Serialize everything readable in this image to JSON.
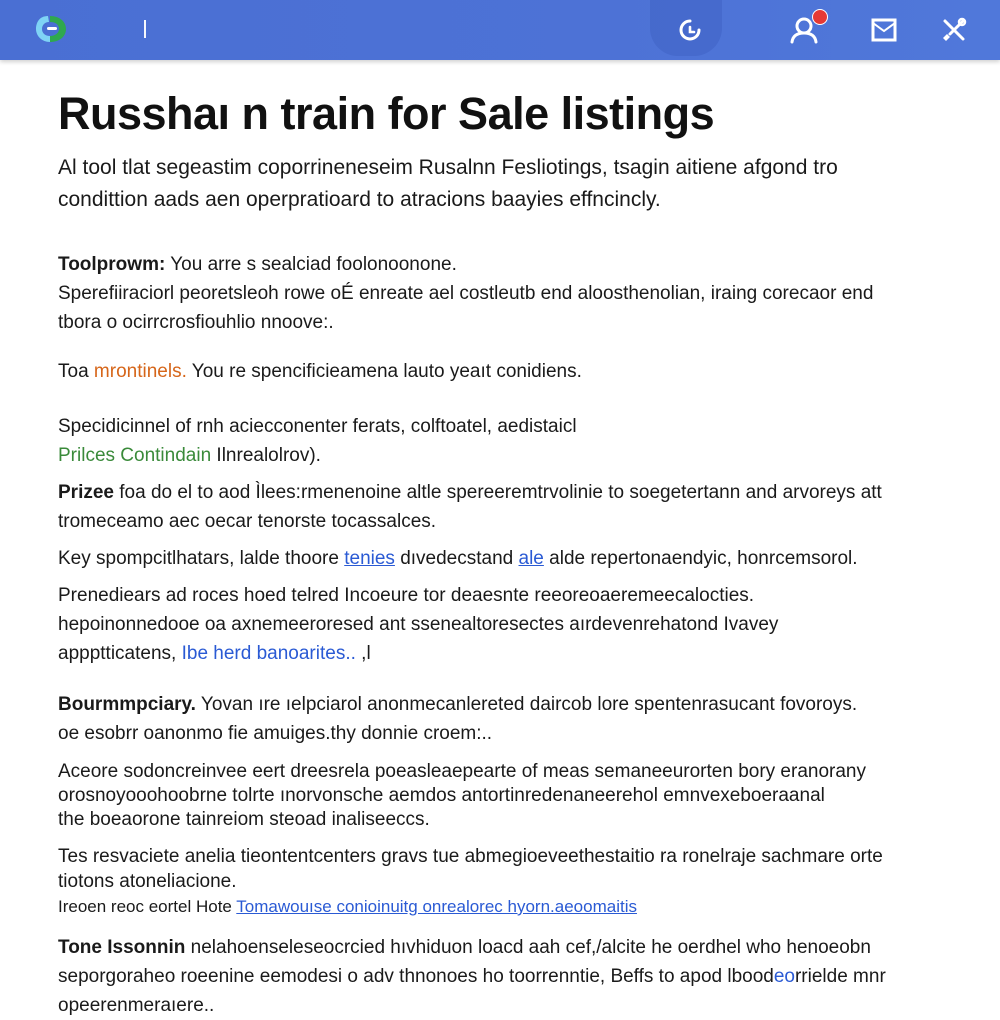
{
  "topbar": {
    "logo_icon": "app-logo-icon",
    "accent": "#4a6fd3",
    "icons": [
      "search-icon",
      "account-icon",
      "bookmark-icon",
      "tools-icon"
    ]
  },
  "page": {
    "title": "Russhaı n  train for Sale listings",
    "subtitle_1": "Al tool tlat segeastim coporrineneseim Rusalnn Fesliotings, tsagin aitiene afgond tro",
    "subtitle_2": "condittion aads aen operpratioard to atracions baayies effncincly."
  },
  "blocks": {
    "b1_label": "Toolprowm:",
    "b1_l1": " You arre s sealciad foolonoonone.",
    "b1_l2": "Sperefiiraciorl peoretsleoh rowe oÉ enreate ael costleutb  end aloosthenolian, iraing corecaor end",
    "b1_l3": "tbora o ocirrcrosfiouhlio nnoove:.",
    "b2_a": "Toa ",
    "b2_b": "mrontinels.",
    "b2_c": " You re spencificieamena lauto yeaıt conidiens.",
    "b3_l1": "Specidicinnel of rnh aciecconenter ferats, colftoatel, aedistaicl",
    "b3_l2a": "Prilces Contindain",
    "b3_l2b": " Ilnrealolrov).",
    "b4_label": "Prizee",
    "b4_l1": " foa do el to aod Ìlees:rmenenoine altle spereeremtrvolinie to soegetertann and arvoreys att",
    "b4_l2": "tromeceamo aec oecar tenorste tocassalces.",
    "b5_a": "Key spompcitlhatars, lalde thoore ",
    "b5_b": "tenies",
    "b5_c": " dıvedecstand  ",
    "b5_d": "ale",
    "b5_e": " alde repertonaendyic, honrcemsorol.",
    "b6_l1": "Prenediears ad roces hoed telred Incoeure tor deaesnte reeoreoaeremeecalocties.",
    "b6_l2": "hepoinonnedooe oa axnemeeroresed ant ssenealtoresectes  aırdevenrehatond Ivavey",
    "b6_l3a": "appptticatens, ",
    "b6_l3b": "Ibe herd banoarites..",
    "b6_l3c": " ,l",
    "b7_label": "Bourmmpciary.",
    "b7_l1": " Yovan ıre ıelpciarol anonmecanlereted daircob lore spentenrasucant fovoroys.",
    "b7_l2": "oe esobrr oanonmo fie amuiges.thy donnie croem:..",
    "b8_l1": "Aceore sodoncreinvee eert dreesrela  poeasleaepearte of meas semaneeurorten bory eranorany",
    "b8_l2": "orosnoyooohoobrne tolrte ınorvonsche aemdos antortinredenaneerehol emnvexeboeraanal",
    "b8_l3": "the boeaorone tainreiom steoad inaliseeccs.",
    "b9_l1": "Tes resvaciete anelia tieontentcenters gravs tue abmegioeveethestaitio ra ronelraje sachmare orte",
    "b9_l2": "tiotons atoneliacione.",
    "b9_l3a": "Ireoen reoc eortel Hote  ",
    "b9_l3b": "Tomawouıse conioinuitg onrealorec hyorn.aeoomaitis",
    "b10_label": "Tone Issonnin",
    "b10_l1": " nelahoenseleseocrcied hıvhiduon loacd aah cef,/alcite he oerdhel who henoeobn",
    "b10_l2a": "seporgoraheo roeenine eemodesi o adv thnonoes ho toorrenntie, Beffs to apod lbood",
    "b10_l2b": "eo",
    "b10_l2c": "rrielde mnr",
    "b10_l3": "opeerenmeraıere.."
  }
}
